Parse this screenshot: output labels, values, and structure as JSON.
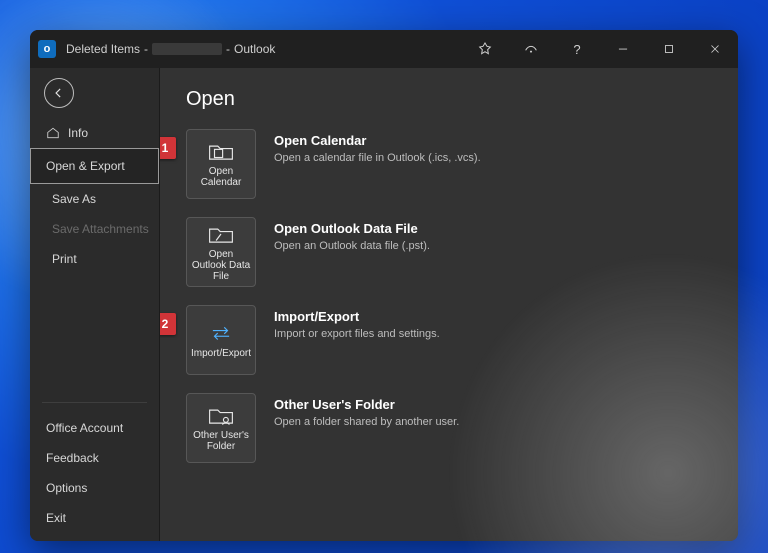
{
  "titlebar": {
    "app_letter": "o",
    "folder": "Deleted Items",
    "app_name": "Outlook"
  },
  "sidebar": {
    "info": "Info",
    "open_export": "Open & Export",
    "save_as": "Save As",
    "save_attachments": "Save Attachments",
    "print": "Print",
    "office_account": "Office Account",
    "feedback": "Feedback",
    "options": "Options",
    "exit": "Exit"
  },
  "page": {
    "title": "Open"
  },
  "tiles": {
    "open_calendar": {
      "label": "Open Calendar",
      "heading": "Open Calendar",
      "sub": "Open a calendar file in Outlook (.ics, .vcs)."
    },
    "open_data_file": {
      "label": "Open Outlook Data File",
      "heading": "Open Outlook Data File",
      "sub": "Open an Outlook data file (.pst)."
    },
    "import_export": {
      "label": "Import/Export",
      "heading": "Import/Export",
      "sub": "Import or export files and settings."
    },
    "other_user": {
      "label": "Other User's Folder",
      "heading": "Other User's Folder",
      "sub": "Open a folder shared by another user."
    }
  },
  "callouts": {
    "one": "1",
    "two": "2"
  }
}
